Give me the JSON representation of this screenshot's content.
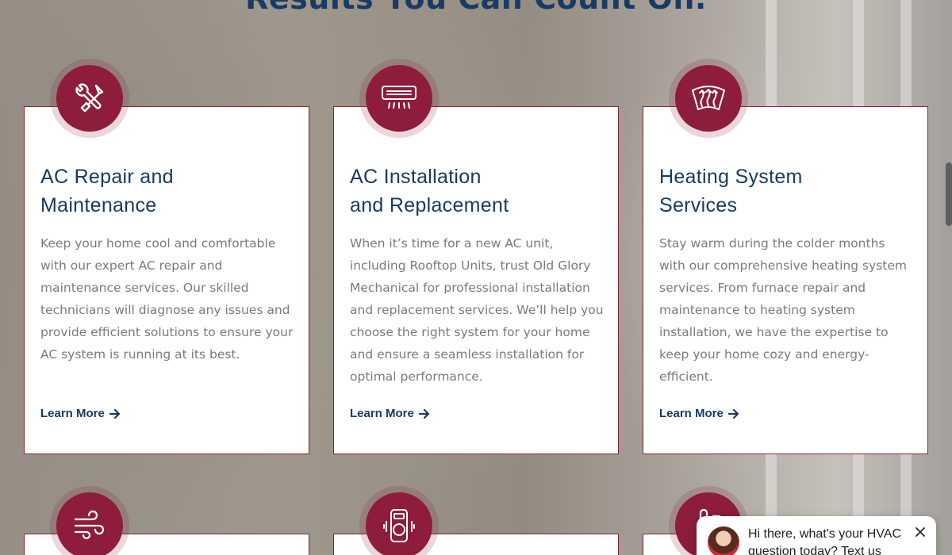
{
  "headline": "Results You Can Count On.",
  "cards": [
    {
      "title": "AC Repair and\nMaintenance",
      "description": "Keep your home cool and comfortable with our expert AC repair and maintenance services. Our skilled technicians will diagnose any issues and provide efficient solutions to ensure your AC system is running at its best.",
      "link": "Learn More",
      "icon": "tools-icon"
    },
    {
      "title": "AC Installation\nand Replacement",
      "description": "When it’s time for a new AC unit, including Rooftop Units, trust Old Glory Mechanical for professional installation and replacement services. We’ll help you choose the right system for your home and ensure a seamless installation for optimal performance.",
      "link": "Learn More",
      "icon": "air-conditioner-icon"
    },
    {
      "title": "Heating System\nServices",
      "description": "Stay warm during the colder months with our comprehensive heating system services. From furnace repair and maintenance to heating system installation, we have the expertise to keep your home cozy and energy-efficient.",
      "link": "Learn More",
      "icon": "heat-waves-icon"
    }
  ],
  "next_row_icons": [
    "wind-icon",
    "air-purifier-icon",
    "thermometer-icon"
  ],
  "chat": {
    "message": "Hi there, what's your HVAC question today? Text us"
  },
  "colors": {
    "brand_maroon": "#8d1d3a",
    "brand_navy": "#173a63"
  }
}
